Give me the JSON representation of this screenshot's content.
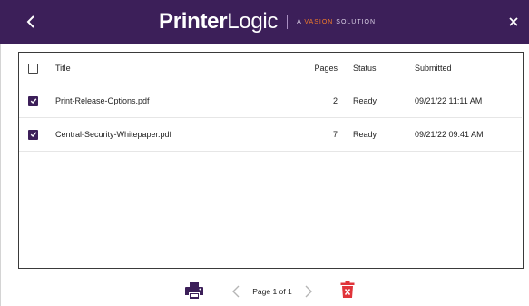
{
  "colors": {
    "brand": "#3c1f59",
    "accent": "#f07a2a",
    "delete": "#e0343a"
  },
  "header": {
    "back_icon": "chevron-left-icon",
    "close_icon": "close-icon",
    "logo": {
      "printer": "Printer",
      "logic": "Logic",
      "tag_prefix": "A ",
      "tag_accent": "VASION",
      "tag_suffix": " SOLUTION"
    }
  },
  "table": {
    "columns": {
      "title": "Title",
      "pages": "Pages",
      "status": "Status",
      "submitted": "Submitted"
    },
    "rows": [
      {
        "checked": true,
        "title": "Print-Release-Options.pdf",
        "pages": "2",
        "status": "Ready",
        "submitted": "09/21/22 11:11 AM"
      },
      {
        "checked": true,
        "title": "Central-Security-Whitepaper.pdf",
        "pages": "7",
        "status": "Ready",
        "submitted": "09/21/22 09:41 AM"
      }
    ]
  },
  "footer": {
    "print_icon": "printer-icon",
    "prev_icon": "chevron-left-icon",
    "page_label": "Page 1 of 1",
    "next_icon": "chevron-right-icon",
    "delete_icon": "trash-icon"
  }
}
